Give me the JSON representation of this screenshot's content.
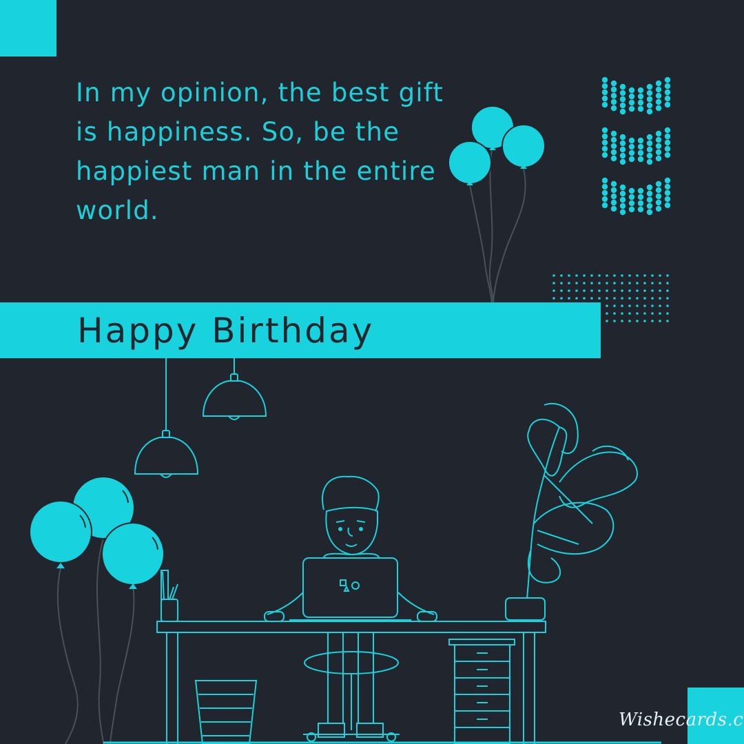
{
  "card": {
    "quote": "In my opinion, the best gift is happiness. So, be the happiest man in the entire world.",
    "title": "Happy Birthday",
    "watermark": "Wishecards.com"
  },
  "colors": {
    "background": "#21252e",
    "accent": "#18d3dd",
    "line": "#1cc6cf",
    "watermark": "#e8f1f4"
  },
  "icons": [
    "balloon-icon",
    "pendant-lamp-icon",
    "plant-icon",
    "laptop-icon",
    "desk-icon",
    "chevron-dots-icon"
  ]
}
